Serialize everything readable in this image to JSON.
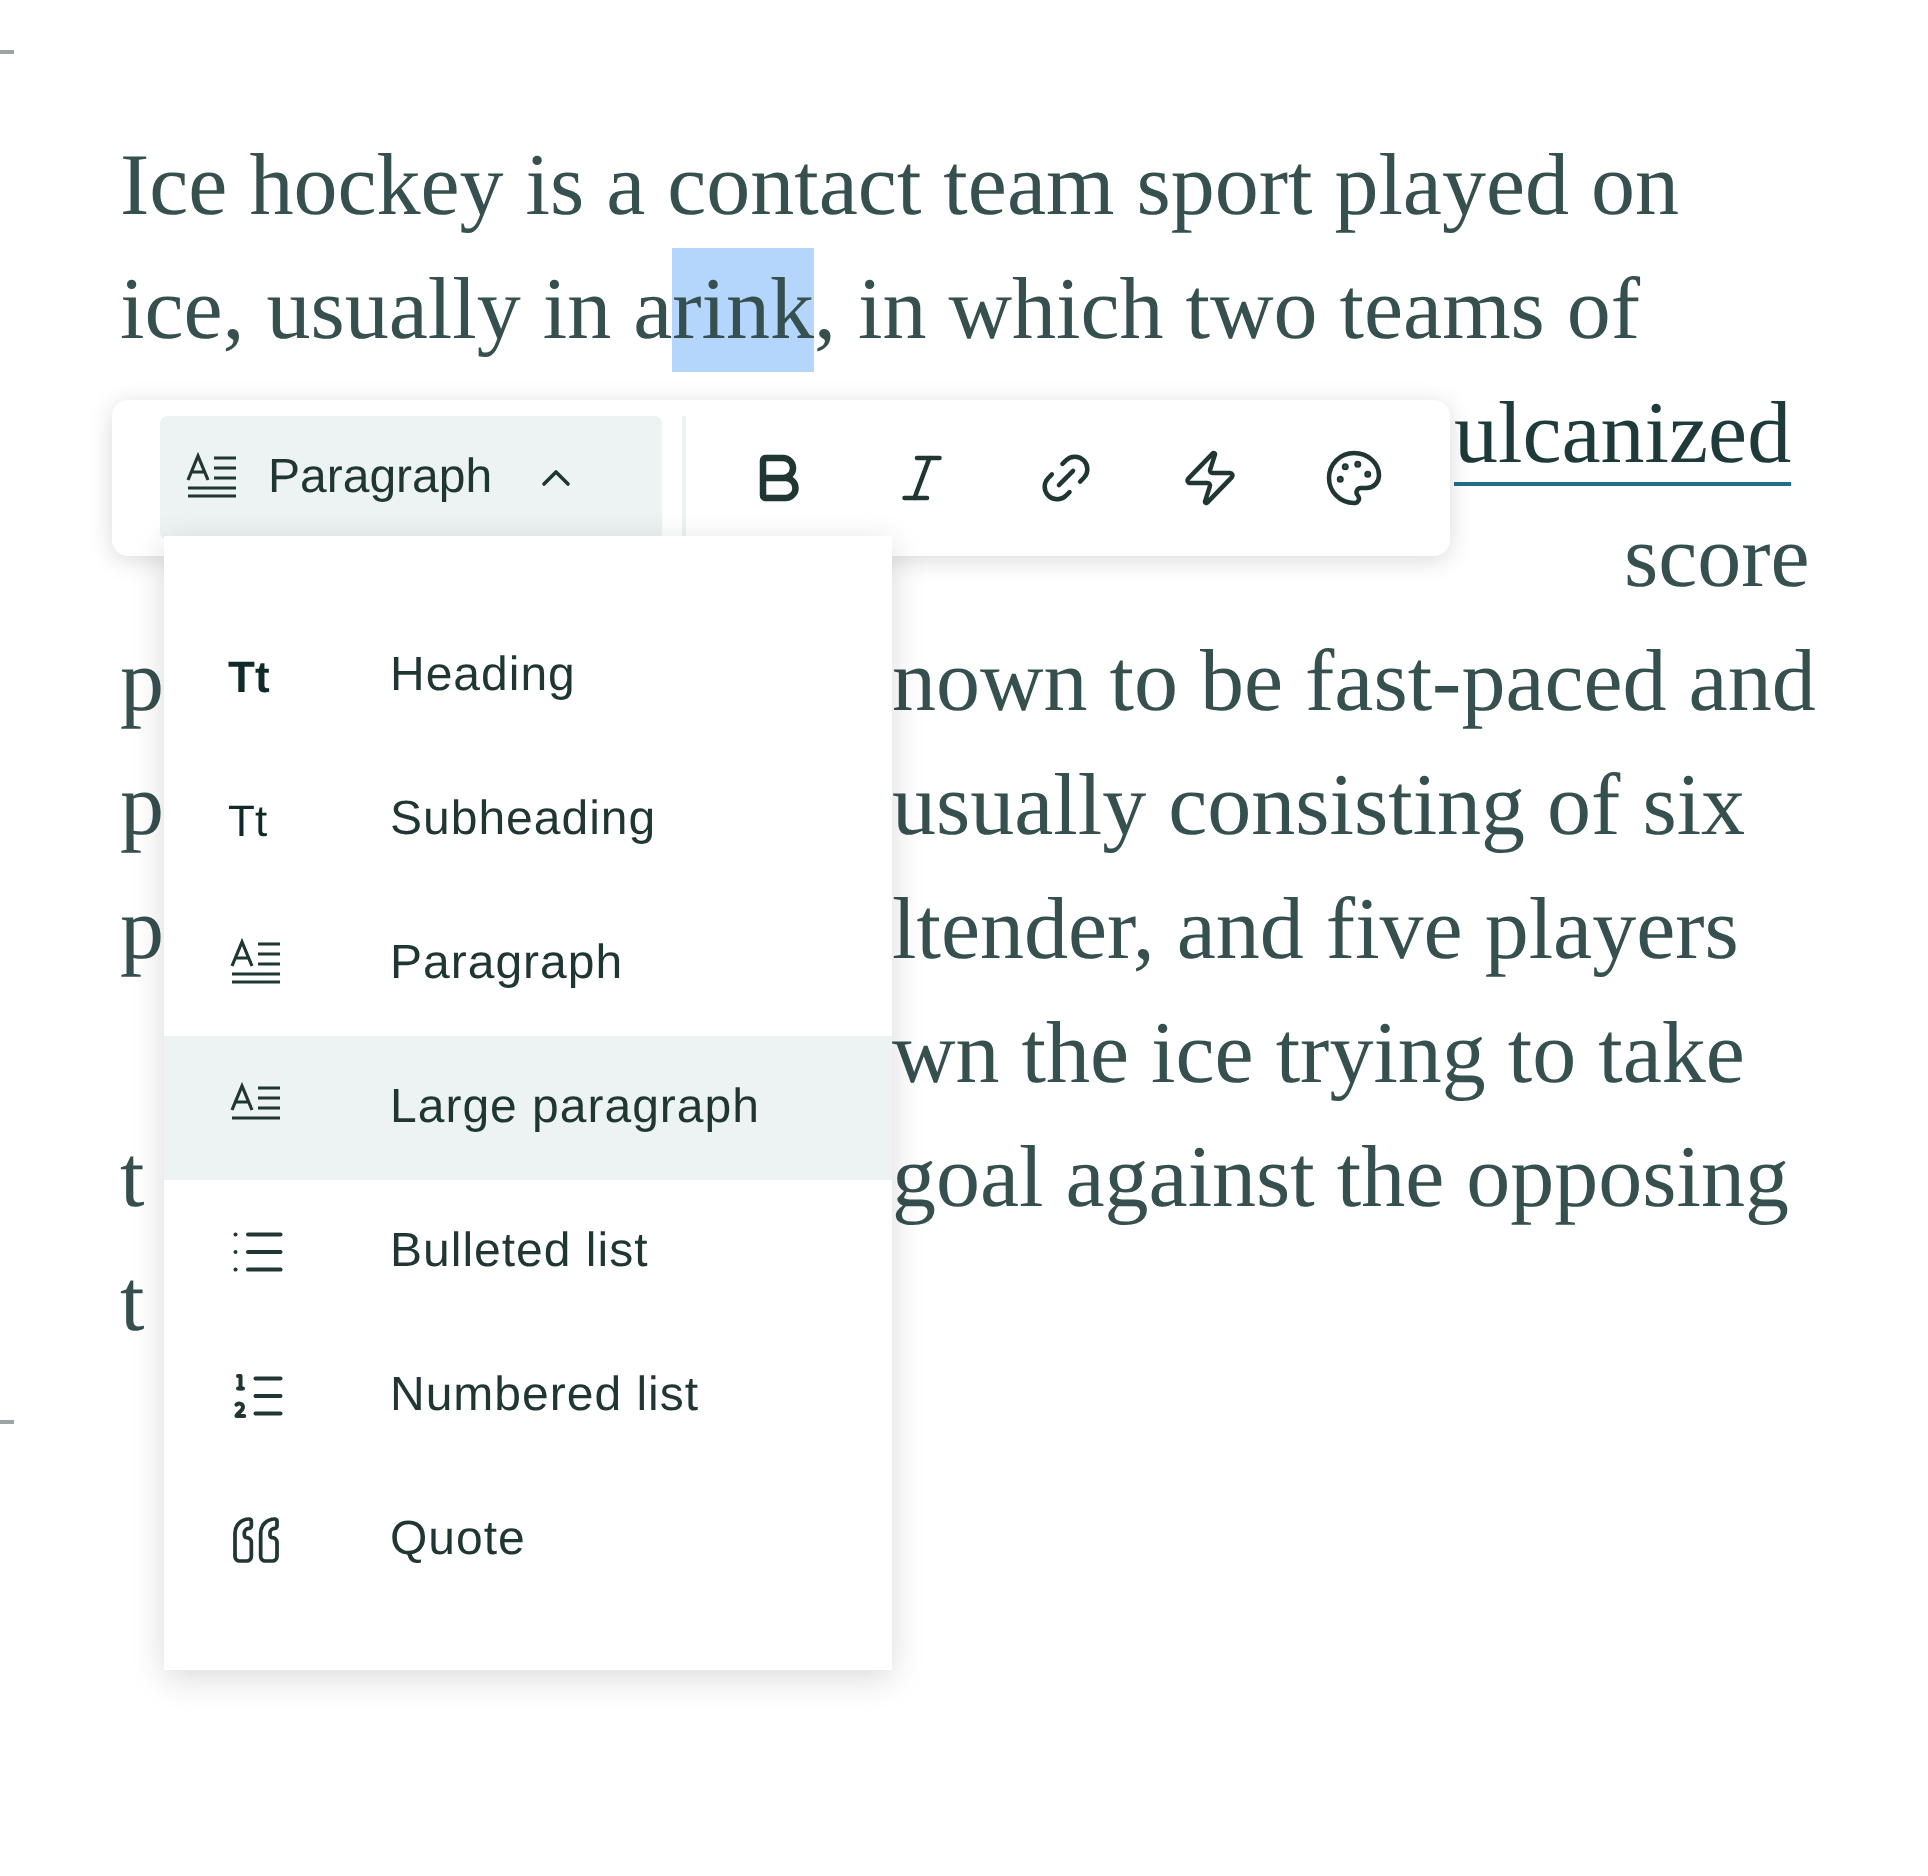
{
  "text_lines": [
    {
      "kind": "full",
      "segments": [
        {
          "kind": "text",
          "text": "Ice hockey is a contact team sport played on",
          "selected": false
        }
      ]
    },
    {
      "kind": "full",
      "segments": [
        {
          "kind": "text",
          "text": "ice, usually in a ",
          "selected": false
        },
        {
          "kind": "text",
          "text": "rink",
          "selected": true
        },
        {
          "kind": "text",
          "text": ", in which two teams of",
          "selected": false
        }
      ]
    },
    {
      "kind": "after-toolbar",
      "segments": [
        {
          "kind": "link",
          "text": "ulcanized",
          "selected": false
        }
      ]
    },
    {
      "kind": "tail",
      "segments": [
        {
          "kind": "text",
          "text": "score",
          "selected": false
        }
      ]
    },
    {
      "kind": "split",
      "left": "p",
      "segments": [
        {
          "kind": "text",
          "text": "nown to be fast-paced and",
          "selected": false
        }
      ]
    },
    {
      "kind": "split",
      "left": "p",
      "segments": [
        {
          "kind": "text",
          "text": "usually consisting of six",
          "selected": false
        }
      ]
    },
    {
      "kind": "split",
      "left": "p",
      "segments": [
        {
          "kind": "text",
          "text": "ltender, and five players",
          "selected": false
        }
      ]
    },
    {
      "kind": "split",
      "segments": [
        {
          "kind": "text",
          "text": "wn the ice trying to take",
          "selected": false
        }
      ]
    },
    {
      "kind": "split",
      "left": "t",
      "segments": [
        {
          "kind": "text",
          "text": "goal against the opposing",
          "selected": false
        }
      ]
    },
    {
      "kind": "split",
      "left": "t"
    }
  ],
  "toolbar": {
    "style_button": {
      "label": "Paragraph",
      "expanded": true
    },
    "tools": [
      {
        "kind": "bold"
      },
      {
        "kind": "italic"
      },
      {
        "kind": "link"
      },
      {
        "kind": "bolt"
      },
      {
        "kind": "palette"
      }
    ]
  },
  "menu": {
    "items": [
      {
        "kind": "heading",
        "glyph": "Tt",
        "label": "Heading",
        "highlighted": false
      },
      {
        "kind": "subheading",
        "glyph": "Tt",
        "label": "Subheading",
        "highlighted": false
      },
      {
        "kind": "paragraph",
        "label": "Paragraph",
        "highlighted": false
      },
      {
        "kind": "large-paragraph",
        "label": "Large paragraph",
        "highlighted": true
      },
      {
        "kind": "bulleted-list",
        "label": "Bulleted list",
        "highlighted": false
      },
      {
        "kind": "numbered-list",
        "label": "Numbered list",
        "highlighted": false
      },
      {
        "kind": "quote",
        "label": "Quote",
        "highlighted": false
      }
    ]
  }
}
